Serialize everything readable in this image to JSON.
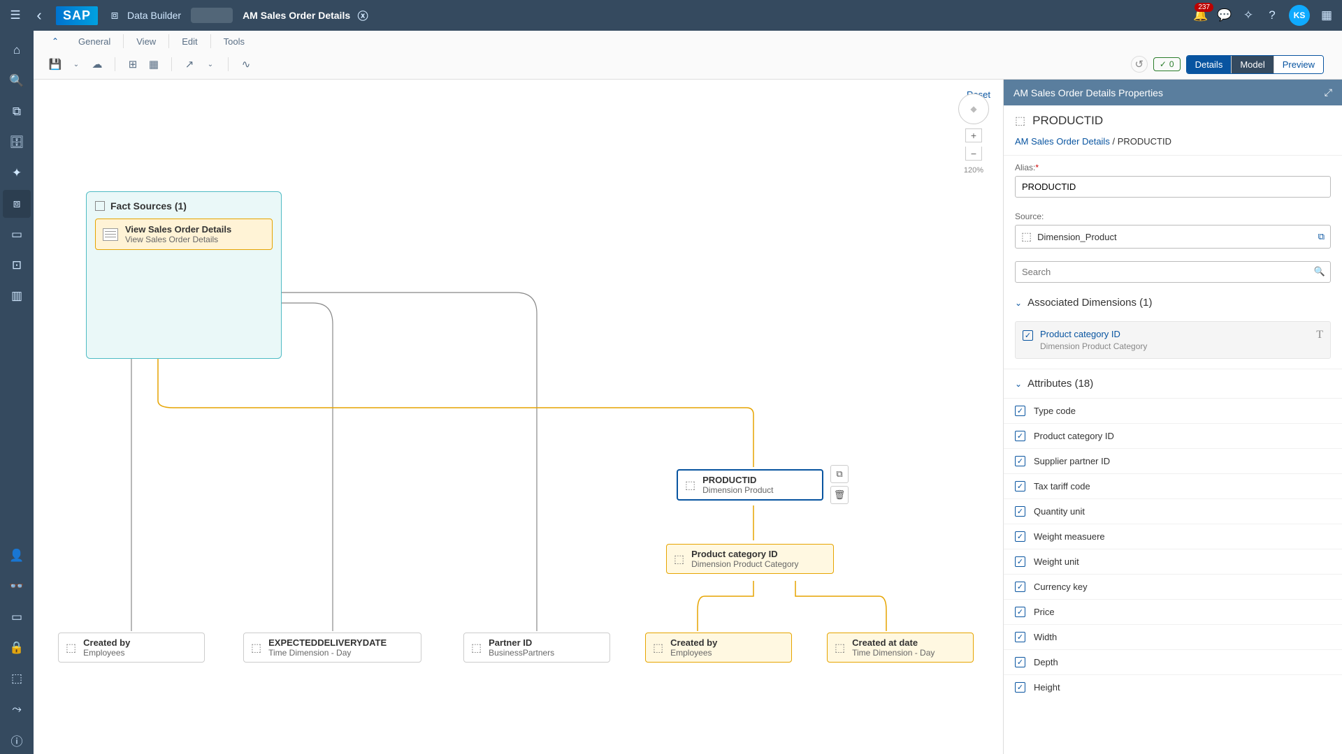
{
  "shell": {
    "logo": "SAP",
    "back_arrow": "‹",
    "breadcrumb_app": "Data Builder",
    "breadcrumb_title": "AM Sales Order Details",
    "notification_count": "237",
    "avatar_initials": "KS"
  },
  "toolbar": {
    "menus": [
      "General",
      "View",
      "Edit",
      "Tools"
    ],
    "reset_label": "Reset",
    "status_count": "0",
    "tabs": {
      "details": "Details",
      "model": "Model",
      "preview": "Preview"
    }
  },
  "canvas": {
    "fact_header": "Fact Sources (1)",
    "fact_source_title": "View Sales Order Details",
    "fact_source_sub": "View Sales Order Details",
    "zoom": "120%",
    "nodes": {
      "productid": {
        "t1": "PRODUCTID",
        "t2": "Dimension Product"
      },
      "prodcat": {
        "t1": "Product category ID",
        "t2": "Dimension Product Category"
      },
      "createdby1": {
        "t1": "Created by",
        "t2": "Employees"
      },
      "expdel": {
        "t1": "EXPECTEDDELIVERYDATE",
        "t2": "Time Dimension - Day"
      },
      "partner": {
        "t1": "Partner ID",
        "t2": "BusinessPartners"
      },
      "createdby2": {
        "t1": "Created by",
        "t2": "Employees"
      },
      "createdat": {
        "t1": "Created at date",
        "t2": "Time Dimension - Day"
      }
    }
  },
  "props": {
    "header": "AM Sales Order Details Properties",
    "title": "PRODUCTID",
    "bc_root": "AM Sales Order Details",
    "bc_current": "PRODUCTID",
    "alias_label": "Alias:",
    "alias_value": "PRODUCTID",
    "source_label": "Source:",
    "source_value": "Dimension_Product",
    "search_placeholder": "Search",
    "assoc_header": "Associated Dimensions (1)",
    "assoc_item_t1": "Product category ID",
    "assoc_item_t2": "Dimension Product Category",
    "attr_header": "Attributes (18)",
    "attributes": [
      "Type code",
      "Product category ID",
      "Supplier partner ID",
      "Tax tariff code",
      "Quantity unit",
      "Weight measuere",
      "Weight unit",
      "Currency key",
      "Price",
      "Width",
      "Depth",
      "Height"
    ]
  }
}
